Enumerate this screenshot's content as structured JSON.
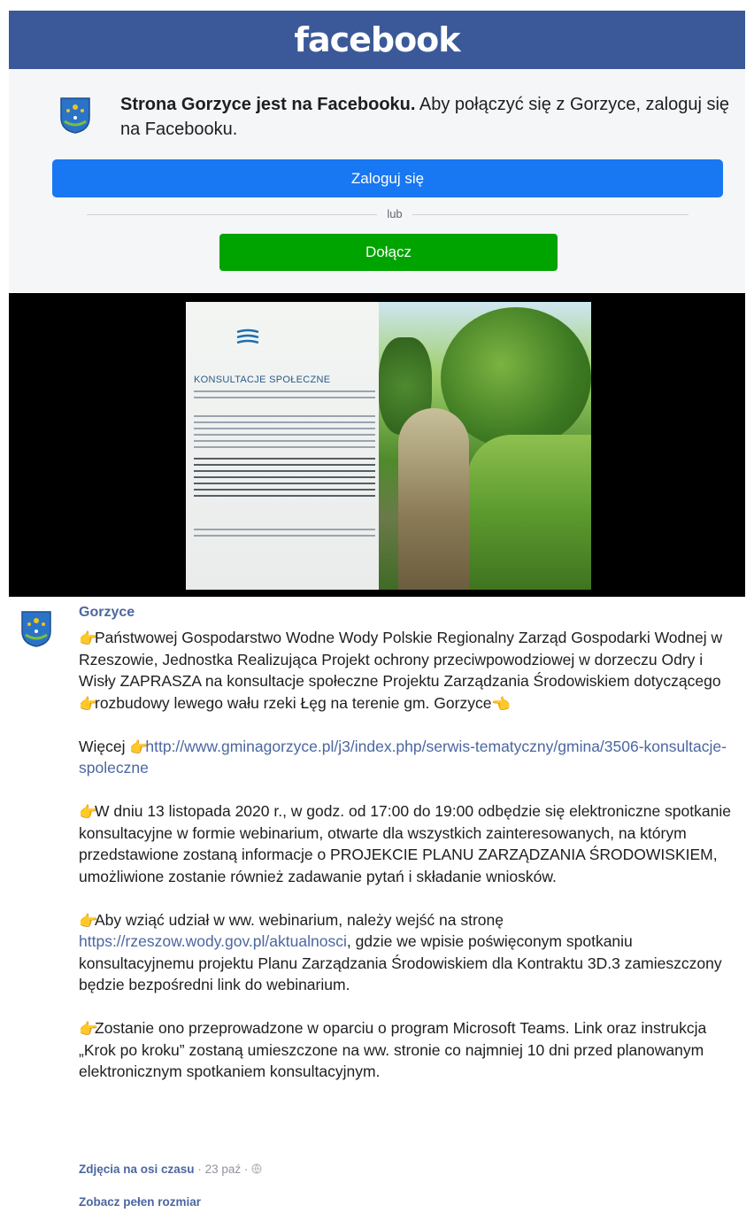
{
  "header": {
    "logo": "facebook"
  },
  "login_panel": {
    "page_name_bold": "Strona Gorzyce jest na Facebooku.",
    "prompt_rest": " Aby połączyć się z Gorzyce, zaloguj się na Facebooku.",
    "login_button": "Zaloguj się",
    "or_text": "lub",
    "join_button": "Dołącz",
    "crest_icon": "crest-icon"
  },
  "media": {
    "poster": {
      "title": "KONSULTACJE SPOŁECZNE"
    }
  },
  "post": {
    "author": "Gorzyce",
    "paragraphs": {
      "p1": "Państwowej Gospodarstwo Wodne Wody Polskie Regionalny Zarząd Gospodarki Wodnej w Rzeszowie, Jednostka Realizująca Projekt ochrony przeciwpowodziowej w dorzeczu Odry i Wisły ZAPRASZA na konsultacje społeczne Projektu Zarządzania Środowiskiem dotyczącego ",
      "p1b": "rozbudowy lewego wału rzeki Łęg na terenie gm. Gorzyce",
      "p2_prefix": "Więcej ",
      "p2_link": "http://www.gminagorzyce.pl/j3/index.php/serwis-tematyczny/gmina/3506-konsultacje-spoleczne",
      "p3": "W dniu 13 listopada 2020 r., w godz. od 17:00 do 19:00 odbędzie się elektroniczne spotkanie konsultacyjne w formie webinarium, otwarte dla wszystkich zainteresowanych, na którym przedstawione zostaną informacje o PROJEKCIE PLANU ZARZĄDZANIA ŚRODOWISKIEM, umożliwione zostanie również zadawanie pytań i składanie wniosków.",
      "p4_prefix": "Aby wziąć udział w ww. webinarium, należy wejść na stronę ",
      "p4_link": "https://rzeszow.wody.gov.pl/aktualnosci",
      "p4_suffix": ", gdzie we wpisie poświęconym spotkaniu konsultacyjnemu projektu Planu Zarządzania Środowiskiem dla Kontraktu 3D.3 zamieszczony będzie bezpośredni link do webinarium.",
      "p5": "Zostanie ono przeprowadzone w oparciu o program Microsoft Teams. Link oraz instrukcja „Krok po kroku” zostaną umieszczone na ww. stronie co najmniej 10 dni przed planowanym elektronicznym spotkaniem konsultacyjnym."
    },
    "footer": {
      "album": "Zdjęcia na osi czasu",
      "sep": " · ",
      "date": "23 paź",
      "sep2": " · ",
      "globe_icon": "globe-icon"
    },
    "full_size": "Zobacz pełen rozmiar"
  },
  "colors": {
    "fb_blue": "#3b5998",
    "login_blue": "#1877f2",
    "join_green": "#00a400",
    "link": "#4b67a1"
  }
}
